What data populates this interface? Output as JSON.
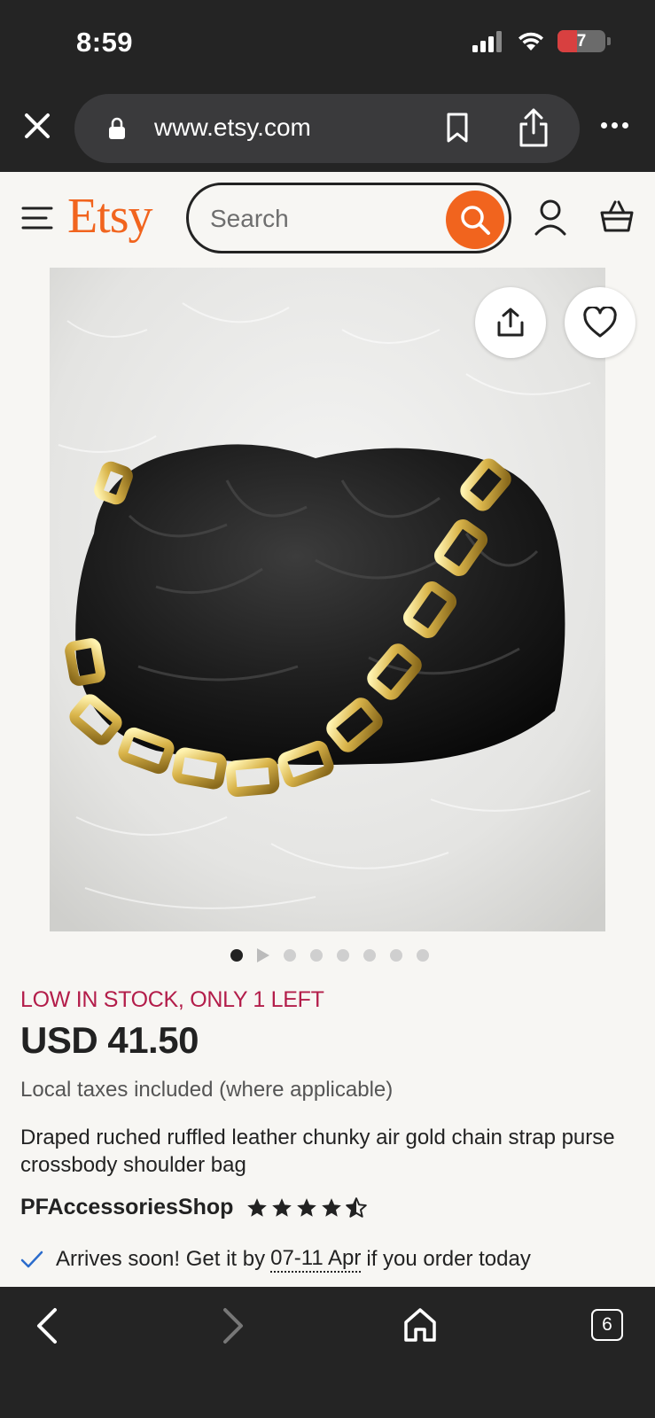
{
  "status_bar": {
    "time": "8:59",
    "battery_level": "7"
  },
  "browser": {
    "url": "www.etsy.com",
    "tab_count": "6"
  },
  "header": {
    "logo": "Etsy",
    "search_placeholder": "Search"
  },
  "product": {
    "image_alt": "Black ruched leather bag with gold chunky chain strap on white fur",
    "image_count": 8,
    "active_image_index": 0,
    "stock_notice": "LOW IN STOCK, ONLY 1 LEFT",
    "price": "USD 41.50",
    "tax_note": "Local taxes included (where applicable)",
    "title": "Draped ruched ruffled leather chunky air gold chain strap purse crossbody shoulder bag",
    "shop_name": "PFAccessoriesShop",
    "rating": 4.5,
    "delivery": {
      "prefix": "Arrives soon! Get it by",
      "date": "07-11 Apr",
      "suffix": "if you order today"
    }
  },
  "colors": {
    "brand": "#f1641e",
    "stock_warning": "#b31d4a",
    "chrome": "#242424",
    "page_bg": "#f7f6f3",
    "check": "#2b6ccc"
  }
}
